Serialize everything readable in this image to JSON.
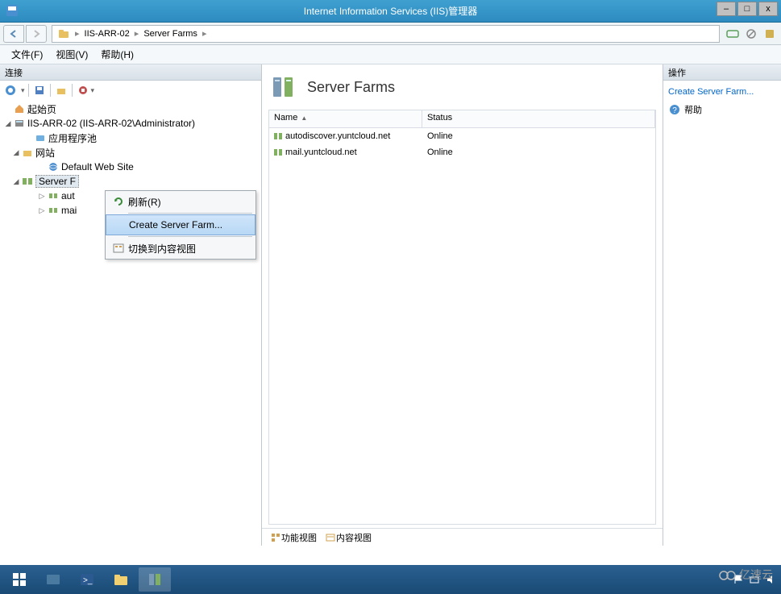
{
  "window": {
    "title": "Internet Information Services (IIS)管理器",
    "minimize": "–",
    "maximize": "□",
    "close": "x"
  },
  "breadcrumb": {
    "host": "IIS-ARR-02",
    "section": "Server Farms"
  },
  "menu": {
    "file": "文件(F)",
    "view": "视图(V)",
    "help": "帮助(H)"
  },
  "left": {
    "header": "连接",
    "nodes": {
      "start": "起始页",
      "host": "IIS-ARR-02 (IIS-ARR-02\\Administrator)",
      "apppools": "应用程序池",
      "sites": "网站",
      "defaultsite": "Default Web Site",
      "serverfarms": "Server F",
      "child1": "aut",
      "child2": "mai"
    }
  },
  "context_menu": {
    "refresh": "刷新(R)",
    "create": "Create Server Farm...",
    "switch": "切换到内容视图"
  },
  "center": {
    "title": "Server Farms",
    "col_name": "Name",
    "col_status": "Status",
    "rows": [
      {
        "name": "autodiscover.yuntcloud.net",
        "status": "Online"
      },
      {
        "name": "mail.yuntcloud.net",
        "status": "Online"
      }
    ],
    "tab_features": "功能视图",
    "tab_content": "内容视图"
  },
  "right": {
    "header": "操作",
    "create_link": "Create Server Farm...",
    "help": "帮助"
  },
  "watermark": "亿速云"
}
